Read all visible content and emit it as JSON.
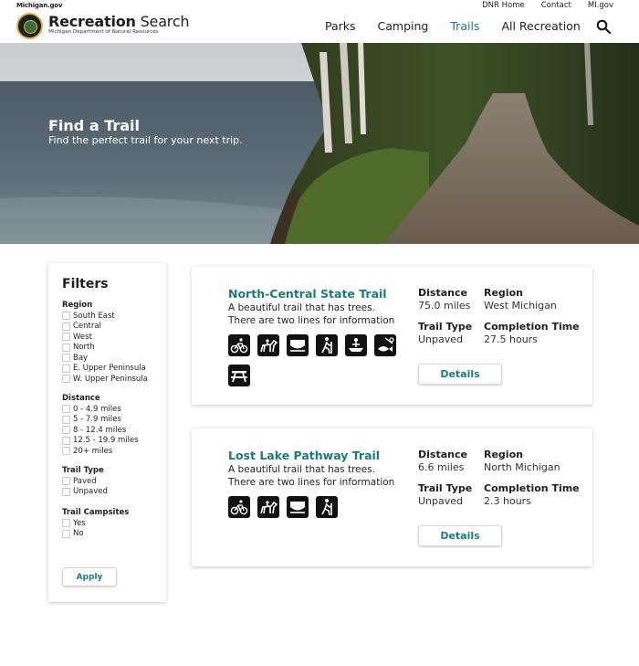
{
  "top_bar": {
    "michigan_gov": "Michigan.gov",
    "links": [
      "DNR Home",
      "Contact",
      "MI.gov"
    ]
  },
  "header": {
    "brand_bold": "Recreation",
    "brand_rest": " Search",
    "brand_sub": "Michigan Department of Natural Resources",
    "nav": [
      "Parks",
      "Camping",
      "Trails",
      "All Recreation"
    ],
    "active_nav": "Trails"
  },
  "hero": {
    "title": "Find a Trail",
    "subtitle": "Find the perfect trail for your next trip."
  },
  "filters": {
    "title": "Filters",
    "groups": [
      {
        "title": "Region",
        "options": [
          "South East",
          "Central",
          "West",
          "North",
          "Bay",
          "E. Upper Peninsula",
          "W. Upper Peninsula"
        ]
      },
      {
        "title": "Distance",
        "options": [
          "0 - 4.9 miles",
          "5 - 7.9 miles",
          "8 - 12.4 miles",
          "12.5 - 19.9 miles",
          "20+ miles"
        ]
      },
      {
        "title": "Trail Type",
        "options": [
          "Paved",
          "Unpaved"
        ]
      },
      {
        "title": "Trail Campsites",
        "options": [
          "Yes",
          "No"
        ]
      }
    ],
    "apply_label": "Apply"
  },
  "results": [
    {
      "name": "North-Central State Trail",
      "description_line1": "A beautiful trail that has trees.",
      "description_line2": "There are two lines for information",
      "labels": {
        "distance": "Distance",
        "region": "Region",
        "trail_type": "Trail Type",
        "completion": "Completion Time"
      },
      "distance": "75.0 miles",
      "region": "West Michigan",
      "trail_type": "Unpaved",
      "completion_time": "27.5 hours",
      "amenities": [
        "bike-icon",
        "horse-icon",
        "snowmobile-icon",
        "hiking-icon",
        "boat-launch-icon",
        "fishing-icon",
        "picnic-table-icon"
      ],
      "details_label": "Details"
    },
    {
      "name": "Lost Lake Pathway Trail",
      "description_line1": "A beautiful trail that has trees.",
      "description_line2": "There are two lines for information",
      "labels": {
        "distance": "Distance",
        "region": "Region",
        "trail_type": "Trail Type",
        "completion": "Completion Time"
      },
      "distance": "6.6 miles",
      "region": "North Michigan",
      "trail_type": "Unpaved",
      "completion_time": "2.3 hours",
      "amenities": [
        "bike-icon",
        "horse-icon",
        "snowmobile-icon",
        "hiking-icon"
      ],
      "details_label": "Details"
    }
  ],
  "colors": {
    "accent": "#1f7a76",
    "text": "#1e1e1e",
    "seal_gold": "#d8b24a"
  }
}
